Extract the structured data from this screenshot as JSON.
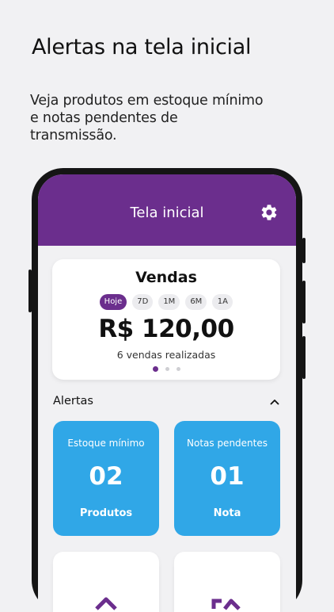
{
  "promo": {
    "headline": "Alertas na tela inicial",
    "subtitle": "Veja produtos em estoque mínimo e notas pendentes de transmissão."
  },
  "appbar": {
    "title": "Tela inicial",
    "settings_icon": "gear-icon",
    "color": "#6b2e8d"
  },
  "sales": {
    "title": "Vendas",
    "periods": [
      "Hoje",
      "7D",
      "1M",
      "6M",
      "1A"
    ],
    "selected_period": "Hoje",
    "amount": "R$ 120,00",
    "count_text": "6 vendas realizadas",
    "page_indicator": {
      "current": 1,
      "total": 3
    }
  },
  "alerts": {
    "title": "Alertas",
    "toggle_icon": "chevron-up-icon",
    "cards": [
      {
        "label": "Estoque mínimo",
        "value": "02",
        "unit": "Produtos"
      },
      {
        "label": "Notas pendentes",
        "value": "01",
        "unit": "Nota"
      }
    ],
    "card_color": "#30a7e7"
  }
}
